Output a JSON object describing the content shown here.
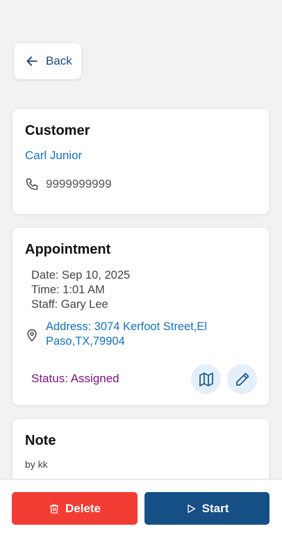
{
  "header": {
    "back_label": "Back"
  },
  "customer": {
    "title": "Customer",
    "name": "Carl Junior",
    "phone": "9999999999"
  },
  "appointment": {
    "title": "Appointment",
    "date": "Date: Sep 10, 2025",
    "time": "Time: 1:01 AM",
    "staff": "Staff: Gary Lee",
    "address_line1": "Address: 3074 Kerfoot Street,El",
    "address_line2": "Paso,TX,79904",
    "status": "Status: Assigned"
  },
  "note": {
    "title": "Note",
    "by": "by kk"
  },
  "actions": {
    "delete_label": "Delete",
    "start_label": "Start"
  },
  "icons": {
    "back": "arrow-left-icon",
    "phone": "phone-icon",
    "location": "map-pin-icon",
    "map": "map-icon",
    "edit": "pencil-icon",
    "delete": "trash-icon",
    "start": "play-icon"
  },
  "colors": {
    "primary": "#164f86",
    "danger": "#f23d35",
    "link": "#1571b8",
    "status": "#7b1580",
    "icon_bg": "#e4effa"
  }
}
